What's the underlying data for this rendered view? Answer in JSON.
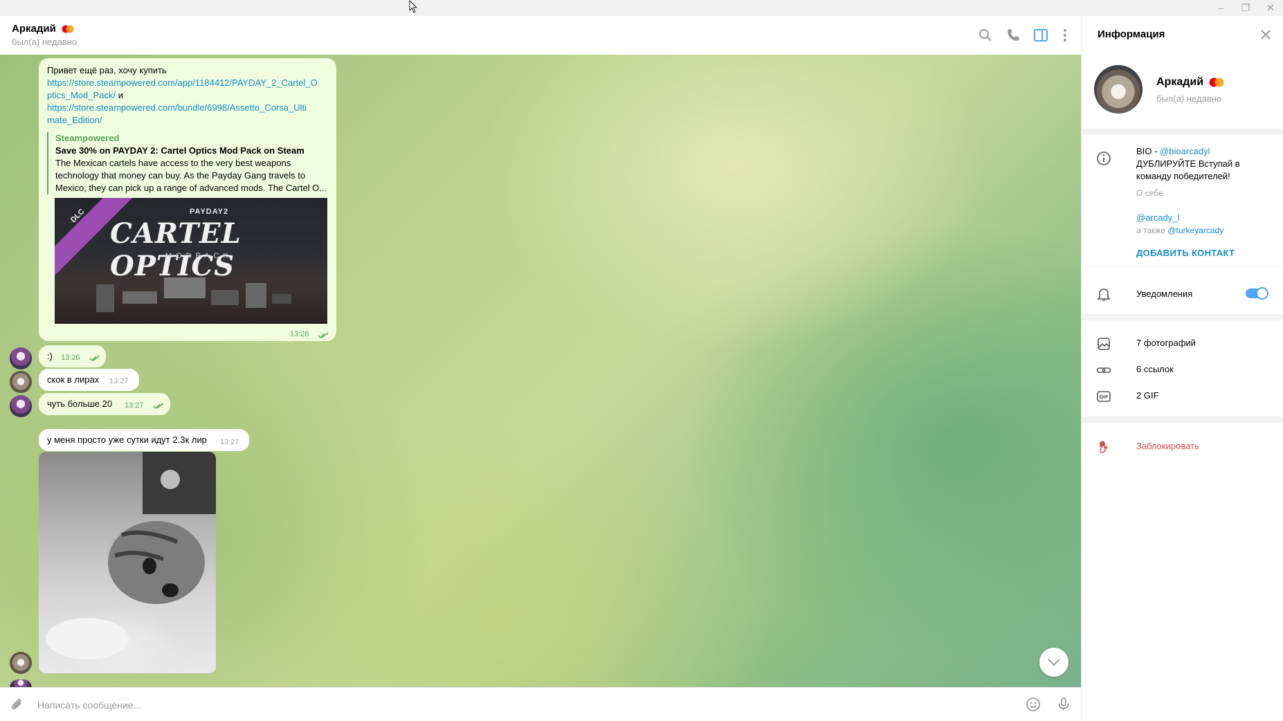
{
  "window": {
    "minimize_label": "–",
    "maximize_label": "❐",
    "close_label": "✕"
  },
  "chat_header": {
    "name": "Аркадий",
    "status": "был(а) недавно"
  },
  "messages": {
    "m1": {
      "text_line": "Привет ещё раз, хочу купить",
      "link1_part1": "https://store.steampowered.com/app/1184412/PAYDAY_2_Cartel_O",
      "link1_part2": "ptics_Mod_Pack/",
      "and_word": " и",
      "link2_part1": "https://store.steampowered.com/bundle/6998/Assetto_Corsa_Ulti",
      "link2_part2": "mate_Edition/",
      "preview": {
        "site": "Steampowered",
        "title": "Save 30% on PAYDAY 2: Cartel Optics Mod Pack on Steam",
        "desc_l1": "The Mexican cartels have access to the very best weapons",
        "desc_l2": "technology that money can buy. As the Payday Gang travels to",
        "desc_l3": "Mexico, they can pick up a range of advanced mods. The Cartel O...",
        "image_text_top": "PAYDAY2",
        "image_text_main": "CARTEL OPTICS",
        "image_text_sub": "MODPACK",
        "image_badge": "DLC"
      },
      "time": "13:26"
    },
    "m2": {
      "text": ":)",
      "time": "13:26"
    },
    "m3": {
      "text": "скок в лирах",
      "time": "13:27"
    },
    "m4": {
      "text": "чуть больше 20",
      "time": "13:27"
    },
    "m5": {
      "text": "у меня просто уже сутки идут 2.3к лир",
      "time": "13:27"
    }
  },
  "composer": {
    "placeholder": "Написать сообщение..."
  },
  "info_panel": {
    "title": "Информация",
    "name": "Аркадий",
    "status": "был(а) недавно",
    "bio_prefix": "BIO - ",
    "bio_handle": "@bioarcadyl",
    "bio_line2": "ДУБЛИРУЙТЕ Вступай в",
    "bio_line3": "команду победителей!",
    "bio_caption": "О себе",
    "username": "@arcady_l",
    "also_prefix": "а также ",
    "also_handle": "@turkeyarcady",
    "add_contact": "ДОБАВИТЬ КОНТАКТ",
    "notifications": "Уведомления",
    "notifications_enabled": true,
    "media": [
      {
        "label": "7 фотографий",
        "icon": "photo-icon"
      },
      {
        "label": "6 ссылок",
        "icon": "link-icon"
      },
      {
        "label": "2 GIF",
        "icon": "gif-icon"
      }
    ],
    "block": "Заблокировать"
  },
  "colors": {
    "outgoing_bubble": "#effdde",
    "incoming_bubble": "#ffffff",
    "link": "#168acd",
    "time_out": "#5fa460",
    "toggle_on": "#4ea4f6",
    "danger": "#d14e4e"
  }
}
